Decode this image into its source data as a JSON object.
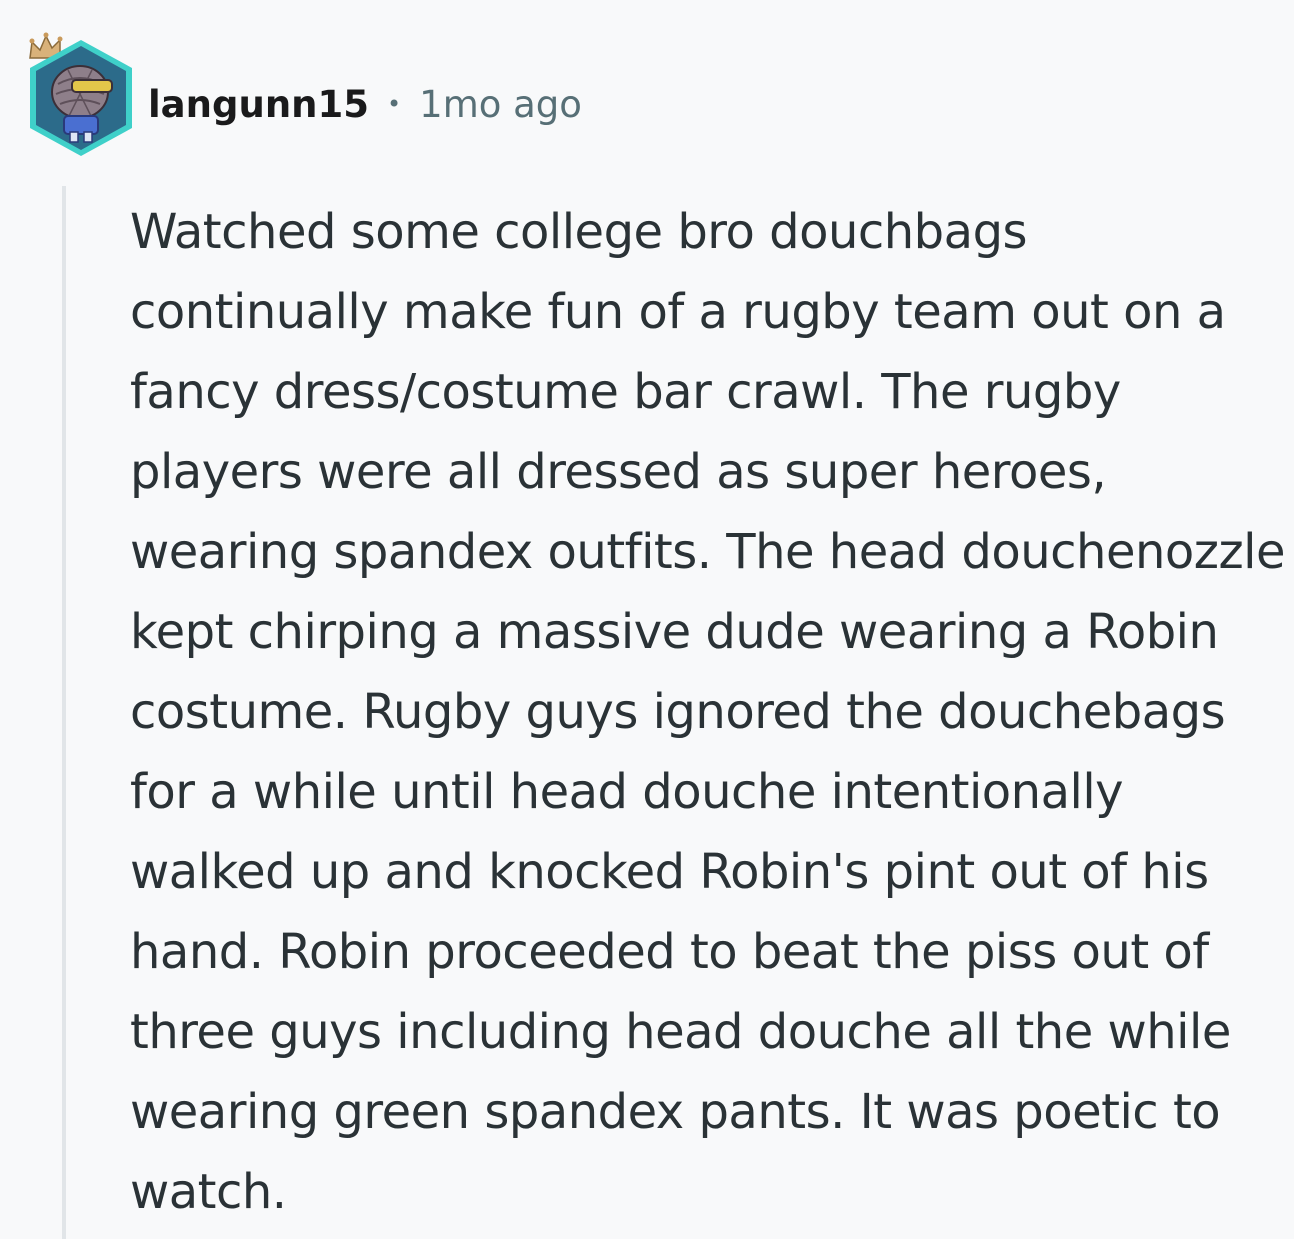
{
  "comment": {
    "username": "langunn15",
    "separator": "•",
    "timestamp": "1mo ago",
    "avatar_icon": "snoo-avatar-with-crown-icon",
    "body": "Watched some college bro douchbags continually make fun of a rugby team out on a fancy dress/costume bar crawl. The rugby players were all dressed as super heroes, wearing spandex outfits. The head douchenozzle kept chirping a massive dude wearing a Robin costume. Rugby guys ignored the douchebags for a while until head douche intentionally walked up and knocked Robin's pint out of his hand. Robin proceeded to beat the piss out of three guys including head douche all the while wearing green spandex pants. It was poetic to watch."
  },
  "colors": {
    "background": "#f8f9fa",
    "username": "#1a1a1b",
    "meta": "#576f76",
    "body_text": "#2a3236",
    "thread_line": "#e1e5e8",
    "avatar_hex_fill": "#2c6b8a",
    "avatar_hex_border": "#3fd0c9"
  }
}
